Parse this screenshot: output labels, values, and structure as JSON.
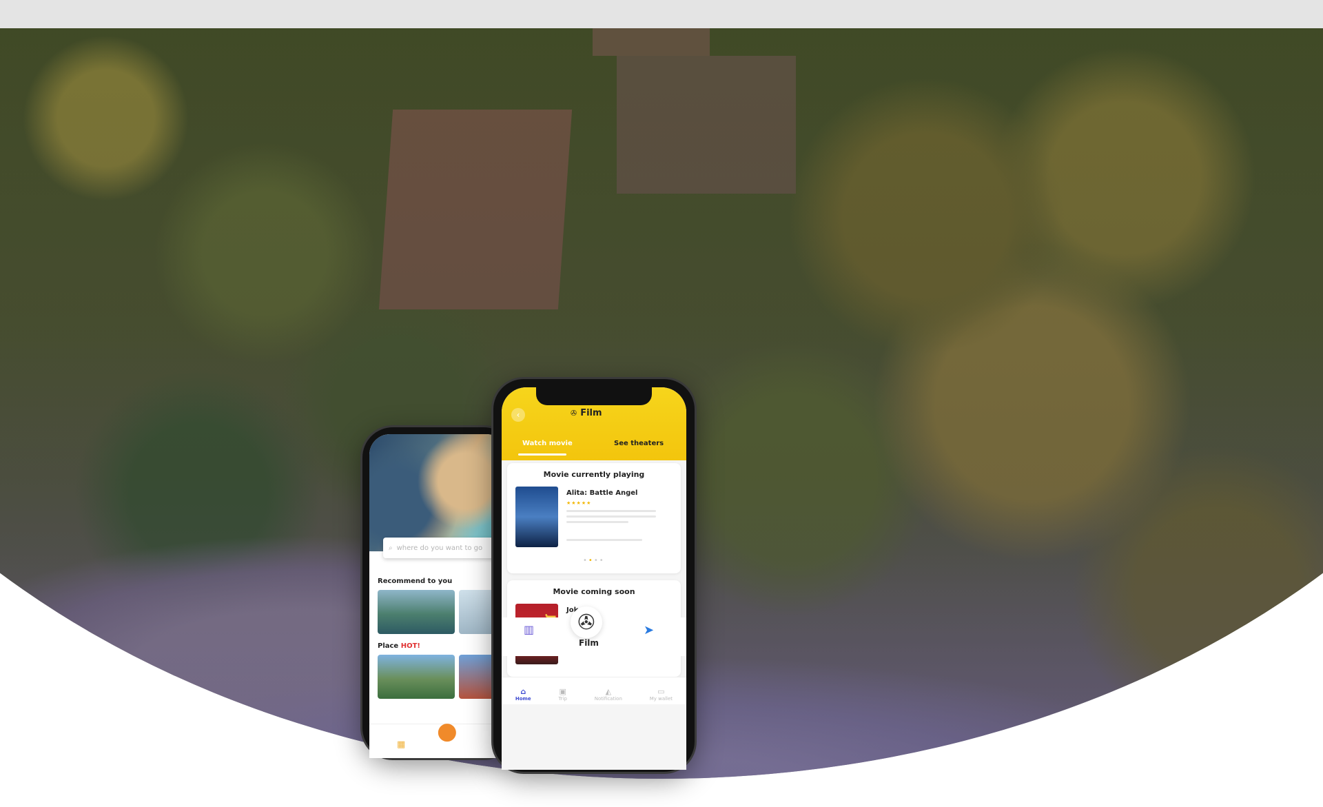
{
  "back_phone": {
    "search_placeholder": "where do you want to go",
    "recommend_title": "Recommend to you",
    "place_title": "Place",
    "place_hot": "HOT!"
  },
  "front_phone": {
    "header_title": "Film",
    "tabs": [
      "Watch movie",
      "See theaters"
    ],
    "section_playing": "Movie currently playing",
    "playing_movie": {
      "name": "Alita: Battle Angel",
      "stars": "★★★★★"
    },
    "section_coming": "Movie coming soon",
    "coming_movie": {
      "name": "Joker",
      "stars": "★★★★★",
      "poster_text": "JOKER"
    },
    "film_label": "Film",
    "nav": [
      "Home",
      "Trip",
      "Notification",
      "My wallet"
    ]
  },
  "colors": {
    "accent_yellow": "#f6d51c",
    "nav_active": "#3d4ad1"
  }
}
